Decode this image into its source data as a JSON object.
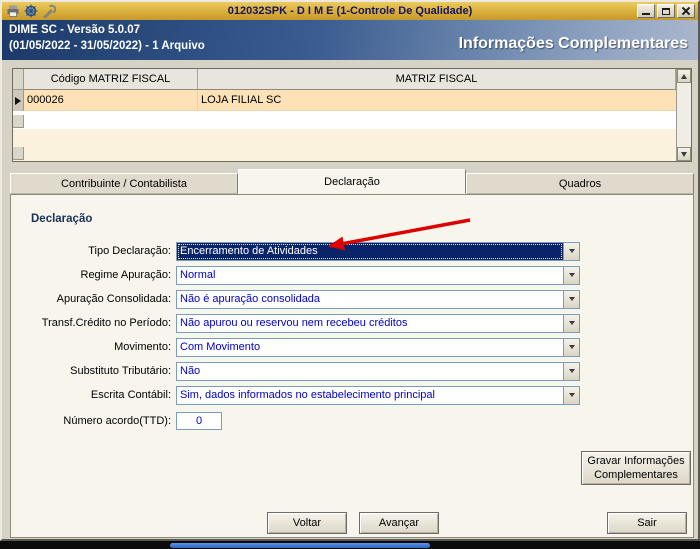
{
  "window": {
    "title": "012032SPK - D I M E (1-Controle De Qualidade)"
  },
  "header": {
    "line1": "DIME SC - Versão 5.0.07",
    "line2": "(01/05/2022 - 31/05/2022) - 1 Arquivo",
    "right_title": "Informações Complementares"
  },
  "grid": {
    "columns": [
      "Código MATRIZ FISCAL",
      "MATRIZ FISCAL"
    ],
    "rows": [
      {
        "codigo": "000026",
        "matriz": "LOJA FILIAL SC"
      }
    ]
  },
  "tabs": [
    {
      "label": "Contribuinte / Contabilista",
      "active": false
    },
    {
      "label": "Declaração",
      "active": true
    },
    {
      "label": "Quadros",
      "active": false
    }
  ],
  "form": {
    "group_title": "Declaração",
    "fields": [
      {
        "label": "Tipo Declaração:",
        "value": "Encerramento de Atividades",
        "selected": true
      },
      {
        "label": "Regime Apuração:",
        "value": "Normal",
        "selected": false
      },
      {
        "label": "Apuração Consolidada:",
        "value": "Não é apuração consolidada",
        "selected": false
      },
      {
        "label": "Transf.Crédito no Período:",
        "value": "Não apurou ou reservou nem recebeu créditos",
        "selected": false
      },
      {
        "label": "Movimento:",
        "value": "Com Movimento",
        "selected": false
      },
      {
        "label": "Substituto Tributário:",
        "value": "Não",
        "selected": false
      },
      {
        "label": "Escrita Contábil:",
        "value": "Sim, dados informados no estabelecimento principal",
        "selected": false
      }
    ],
    "ttd_label": "Número acordo(TTD):",
    "ttd_value": "0"
  },
  "buttons": {
    "gravar": "Gravar Informações Complementares",
    "voltar": "Voltar",
    "avancar": "Avançar",
    "sair": "Sair"
  },
  "colors": {
    "titlebar_gold": "#D9AE3A",
    "header_blue": "#1B3A6A",
    "selected_row": "#FCE2B6",
    "dropdown_text": "#0000C8",
    "selection_bg": "#0A246A",
    "annotation_red": "#DE0000"
  }
}
